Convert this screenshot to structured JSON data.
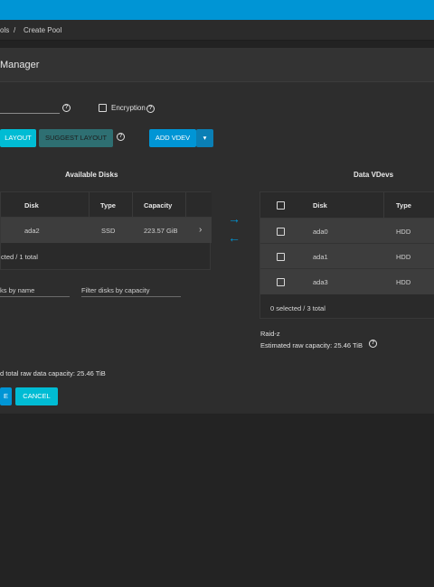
{
  "breadcrumb": {
    "parent": "ols",
    "separator": "/",
    "current": "Create Pool"
  },
  "page": {
    "title": "Manager"
  },
  "form": {
    "encryption_label": "Encryption",
    "help_glyph": "?"
  },
  "buttons": {
    "reset_layout": "LAYOUT",
    "suggest_layout": "SUGGEST LAYOUT",
    "add_vdev": "ADD VDEV",
    "add_vdev_caret": "▾",
    "create": "E",
    "cancel": "CANCEL"
  },
  "available": {
    "title": "Available Disks",
    "columns": [
      "Disk",
      "Type",
      "Capacity"
    ],
    "rows": [
      {
        "disk": "ada2",
        "type": "SSD",
        "capacity": "223.57 GiB",
        "chevron": "›"
      }
    ],
    "footer": "cted / 1 total",
    "filter_name": "ks by name",
    "filter_capacity": "Filter disks by capacity"
  },
  "transfer": {
    "right_arrow": "→",
    "left_arrow": "←"
  },
  "vdevs": {
    "title": "Data VDevs",
    "columns": [
      "Disk",
      "Type"
    ],
    "rows": [
      {
        "disk": "ada0",
        "type": "HDD"
      },
      {
        "disk": "ada1",
        "type": "HDD"
      },
      {
        "disk": "ada3",
        "type": "HDD"
      }
    ],
    "footer": "0 selected / 3 total",
    "layout": "Raid-z",
    "estimated": "Estimated raw capacity: 25.46 TiB"
  },
  "summary": {
    "total_capacity": "d total raw data capacity: 25.46 TiB"
  },
  "colors": {
    "accent": "#0095d5",
    "cyan": "#00bcd4",
    "teal": "#2e6f72",
    "background": "#232323",
    "card": "#2d2d2d"
  }
}
